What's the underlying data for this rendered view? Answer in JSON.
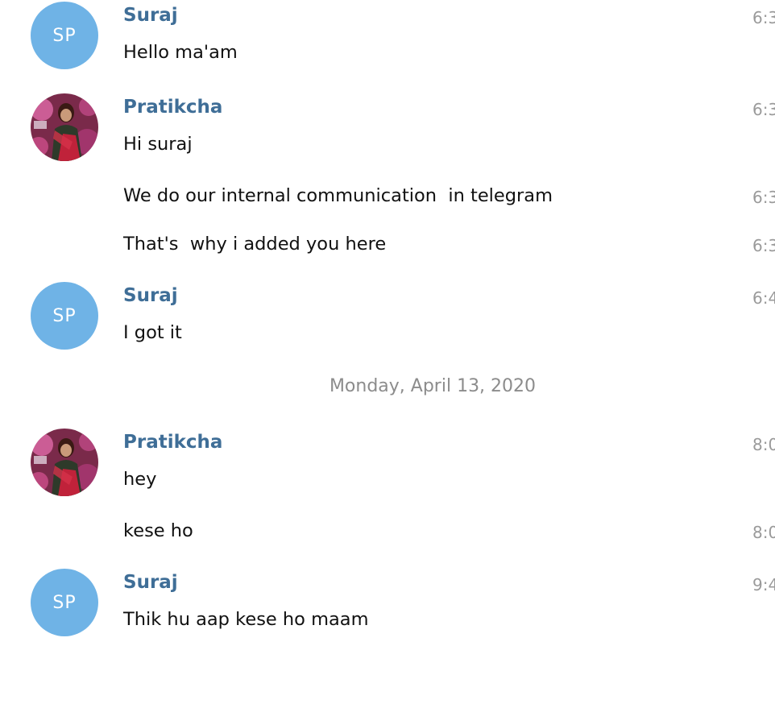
{
  "date_separator": "Monday, April 13, 2020",
  "groups": [
    {
      "sender": "Suraj",
      "avatar_initials": "SP",
      "messages": [
        {
          "text": "Hello ma'am",
          "time": "6:3"
        }
      ]
    },
    {
      "sender": "Pratikcha",
      "messages": [
        {
          "text": "Hi suraj",
          "time": "6:3"
        },
        {
          "text": "We do our internal communication  in telegram",
          "time": "6:3"
        },
        {
          "text": "That's  why i added you here",
          "time": "6:3"
        }
      ]
    },
    {
      "sender": "Suraj",
      "avatar_initials": "SP",
      "messages": [
        {
          "text": "I got it",
          "time": "6:4"
        }
      ]
    },
    {
      "sender": "Pratikcha",
      "messages": [
        {
          "text": "hey",
          "time": "8:0"
        },
        {
          "text": "kese ho",
          "time": "8:0"
        }
      ]
    },
    {
      "sender": "Suraj",
      "avatar_initials": "SP",
      "messages": [
        {
          "text": "Thik hu aap kese ho maam",
          "time": "9:4"
        }
      ]
    }
  ],
  "colors": {
    "sender_name": "#3f6e97",
    "initials_avatar_bg": "#6fb3e6",
    "time": "#9a9a9a",
    "date_separator": "#8c8c8c"
  }
}
